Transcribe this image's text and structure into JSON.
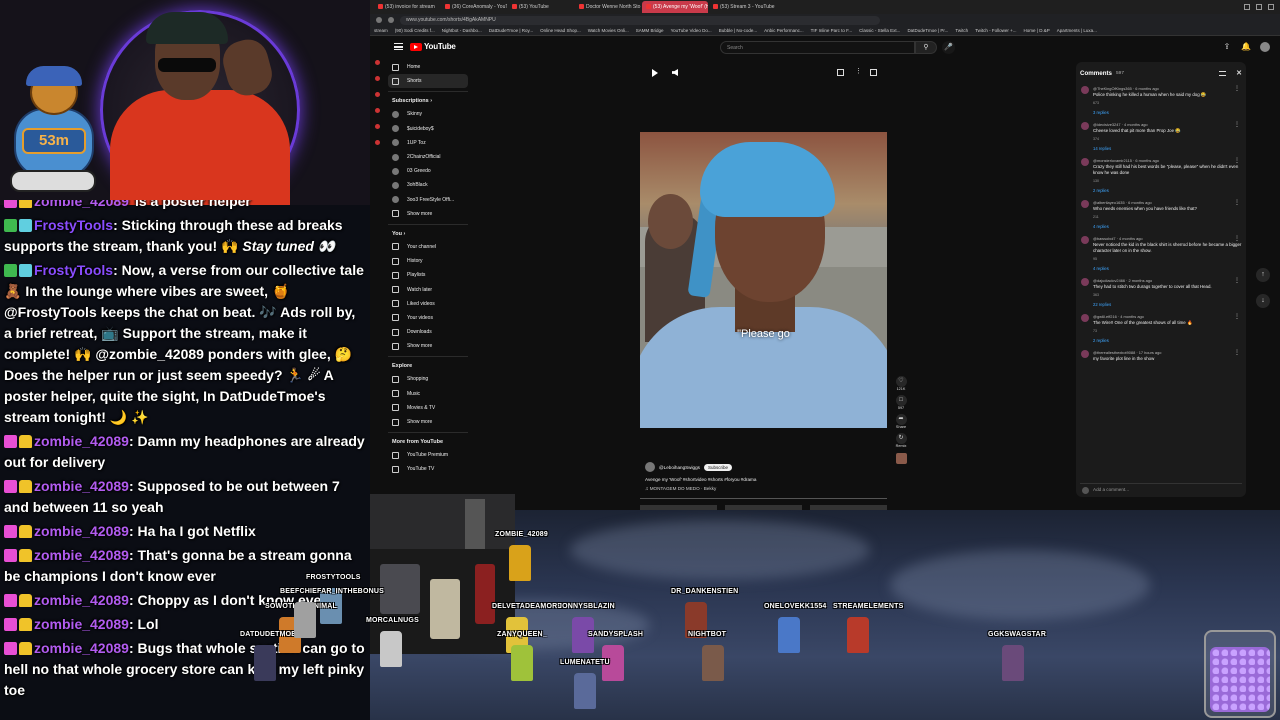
{
  "webcam": {
    "logo_badge": "53m"
  },
  "chat": {
    "messages": [
      {
        "user": "zombie_42089",
        "text": "is a poster helper",
        "style": "zombie",
        "cut": true
      },
      {
        "user": "FrostyTools",
        "text": ": Sticking through these ad breaks supports the stream, thank you! 🙌 ",
        "italic_tail": "Stay tuned 👀",
        "style": "frosty"
      },
      {
        "user": "FrostyTools",
        "text": ": Now, a verse from our collective tale 🧸 In the lounge where vibes are sweet, 🍯 @FrostyTools keeps the chat on beat. 🎶 Ads roll by, a brief retreat, 📺 Support the stream, make it complete! 🙌 @zombie_42089 ponders with glee, 🤔 Does the helper run or just seem speedy? 🏃 ☄ A poster helper, quite the sight, In DatDudeTmoe's stream tonight! 🌙 ✨",
        "style": "frosty"
      },
      {
        "user": "zombie_42089",
        "text": ": Damn my headphones are already out for delivery",
        "style": "zombie"
      },
      {
        "user": "zombie_42089",
        "text": ": Supposed to be out between 7 and between 11 so yeah",
        "style": "zombie"
      },
      {
        "user": "zombie_42089",
        "text": ": Ha ha I got Netflix",
        "style": "zombie"
      },
      {
        "user": "zombie_42089",
        "text": ": That's gonna be a stream gonna be champions I don't know ever",
        "style": "zombie"
      },
      {
        "user": "zombie_42089",
        "text": ": Choppy as I don't know ever",
        "style": "zombie"
      },
      {
        "user": "zombie_42089",
        "text": ": Lol",
        "style": "zombie"
      },
      {
        "user": "zombie_42089",
        "text": ": Bugs that whole section can go to hell no that whole grocery store can kiss my left pinky toe",
        "style": "zombie"
      }
    ]
  },
  "browser": {
    "tabs": [
      "(53) invoice for stream",
      "(36) CoreAnomaly - YouTu",
      "(53) YouTube",
      "Doctor Wenne North Sto",
      "(53) Avenge my 'Woof' (hi",
      "(53) Stream 3 - YouTube"
    ],
    "active_tab_index": 4,
    "address": "www.youtube.com/shorts/4BgAkAMNPU",
    "bookmarks": [
      "stream",
      "(90) Sodi Credits f...",
      "Nightbot - Dashbo...",
      "DatDudeTmoe | Roy...",
      "Online Head Shop...",
      "Watch Movies Onli...",
      "SAMM Bridge",
      "YouTube Video Do...",
      "Bubble | No-code...",
      "Anbic Performanc...",
      "TIF Inline Parc to F...",
      "Classic - Stella Ext...",
      "DatDudeTmoe | Pr...",
      "Twitch",
      "Twitch - Follower +...",
      "Home | D.&P",
      "Apartments | Luxa..."
    ]
  },
  "youtube": {
    "logo": "YouTube",
    "search_placeholder": "Search",
    "sidebar": {
      "top": [
        {
          "label": "Home"
        },
        {
          "label": "Shorts",
          "active": true
        }
      ],
      "subscriptions_header": "Subscriptions ›",
      "subscriptions": [
        "Skinny",
        "$uicideboy$",
        "1UP Toz",
        "2ChainzOfficial",
        "03 Greedo",
        "3ohBlack",
        "3oo3 FreeStyle Offi...",
        "Show more"
      ],
      "you_header": "You ›",
      "you": [
        "Your channel",
        "History",
        "Playlists",
        "Watch later",
        "Liked videos",
        "Your videos",
        "Downloads",
        "Show more"
      ],
      "explore_header": "Explore",
      "explore": [
        "Shopping",
        "Music",
        "Movies & TV",
        "Show more"
      ],
      "more_header": "More from YouTube",
      "more": [
        "YouTube Premium",
        "YouTube TV"
      ]
    },
    "short": {
      "caption": "\"Please go",
      "channel": "@LeboihangSwiggs",
      "subscribe": "Subscribe",
      "title": "Avenge my 'Woof' #shortvideo #shorts #foryou #drama",
      "music": "♫ MONTAGEM DO MEDO · Bekky",
      "actions": [
        "121K",
        "597",
        "Share",
        "Remix"
      ]
    },
    "comments": {
      "title": "Comments",
      "count": "597",
      "add_placeholder": "Add a comment...",
      "items": [
        {
          "user": "@TheKingOfKings365 · 6 months ago",
          "text": "Police thinking he killed a human when he said my dog 😂",
          "likes": "673",
          "replies": "3 replies"
        },
        {
          "user": "@idecisive3247 · 4 months ago",
          "text": "Cheese loved that pit more than Prop Joe 😂",
          "likes": "374",
          "replies": "14 replies"
        },
        {
          "user": "@monsterlovamir2115 · 6 months ago",
          "text": "Crazy they still had his best words be \"please, please\" when he didn't even know he was done",
          "likes": "130",
          "replies": "2 replies"
        },
        {
          "user": "@albertlayeo1635 · 6 months ago",
          "text": "Who needs enemies when you have friends like that?",
          "likes": "211",
          "replies": "4 replies"
        },
        {
          "user": "@bawsobol7 · 4 months ago",
          "text": "Never noticed the kid in the black shirt is sherrod before he became a bigger character later on in the show.",
          "likes": "95",
          "replies": "4 replies"
        },
        {
          "user": "@dajudiaclov2466 · 2 months ago",
          "text": "They had to stitch two durags together to cover all that Head.",
          "likes": "363",
          "replies": "22 replies"
        },
        {
          "user": "@gw6l.eff216 · 4 months ago",
          "text": "The Wire!! One of the greatest shows of all time 🔥",
          "likes": "73",
          "replies": "2 replies"
        },
        {
          "user": "@thereallesthexbot9088 · 17 hours ago",
          "text": "my favorite plot line in the show",
          "likes": "",
          "replies": ""
        }
      ]
    }
  },
  "game": {
    "players": [
      "ZOMBIE_42089",
      "FROSTYTOOLS",
      "SOWOTHEMANIMAL",
      "MORCALNUGS",
      "DELVETADEAMORE",
      "JONNYSBLAZIN",
      "DR_DANKENSTIEN",
      "ONELOVEKK1554",
      "STREAMELEMENTS",
      "DATDUDETMOE",
      "ZANYQUEEN_",
      "SANDYSPLASH",
      "NIGHTBOT",
      "LUMENATETU",
      "GGKSWAGSTAR",
      "BEEFCHIEFAR_INTHEBONUS"
    ]
  }
}
